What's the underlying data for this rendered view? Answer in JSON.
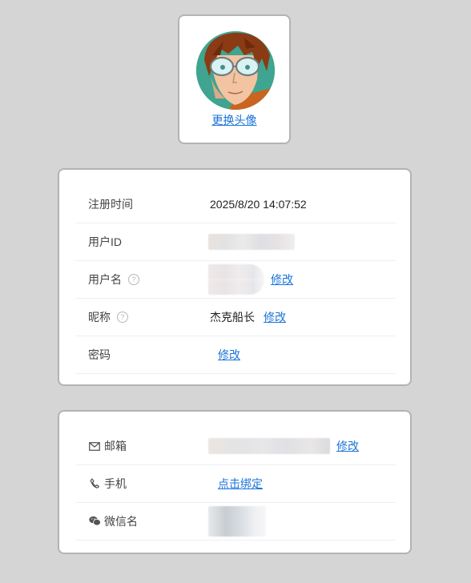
{
  "avatar_card": {
    "change_avatar_label": "更换头像"
  },
  "info": {
    "rows": [
      {
        "label": "注册时间",
        "value": "2025/8/20 14:07:52"
      },
      {
        "label": "用户ID",
        "value": ""
      },
      {
        "label": "用户名",
        "action": "修改"
      },
      {
        "label": "昵称",
        "value": "杰克船长",
        "action": "修改"
      },
      {
        "label": "密码",
        "action": "修改"
      }
    ]
  },
  "contact": {
    "rows": [
      {
        "label": "邮箱",
        "icon": "mail-icon",
        "action": "修改"
      },
      {
        "label": "手机",
        "icon": "phone-icon",
        "action": "点击绑定"
      },
      {
        "label": "微信名",
        "icon": "wechat-icon"
      }
    ]
  },
  "colors": {
    "background": "#d6d5d5",
    "card": "#ffffff",
    "link": "#1a73d9",
    "divider": "#eceff3"
  }
}
